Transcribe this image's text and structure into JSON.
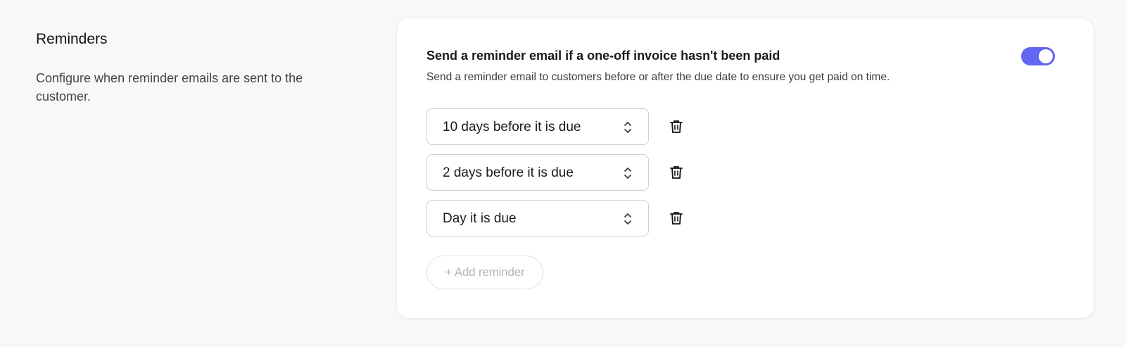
{
  "section": {
    "title": "Reminders",
    "description": "Configure when reminder emails are sent to the customer."
  },
  "card": {
    "title": "Send a reminder email if a one-off invoice hasn't been paid",
    "subtitle": "Send a reminder email to customers before or after the due date to ensure you get paid on time.",
    "toggle_on": true,
    "accent_color": "#6366f1"
  },
  "reminders": [
    {
      "label": "10 days before it is due",
      "icon": "chevron-up-down-icon",
      "delete_icon": "trash-icon"
    },
    {
      "label": "2 days before it is due",
      "icon": "chevron-up-down-icon",
      "delete_icon": "trash-icon"
    },
    {
      "label": "Day it is due",
      "icon": "chevron-up-down-icon",
      "delete_icon": "trash-icon"
    }
  ],
  "add_button": {
    "label": "+ Add reminder"
  }
}
